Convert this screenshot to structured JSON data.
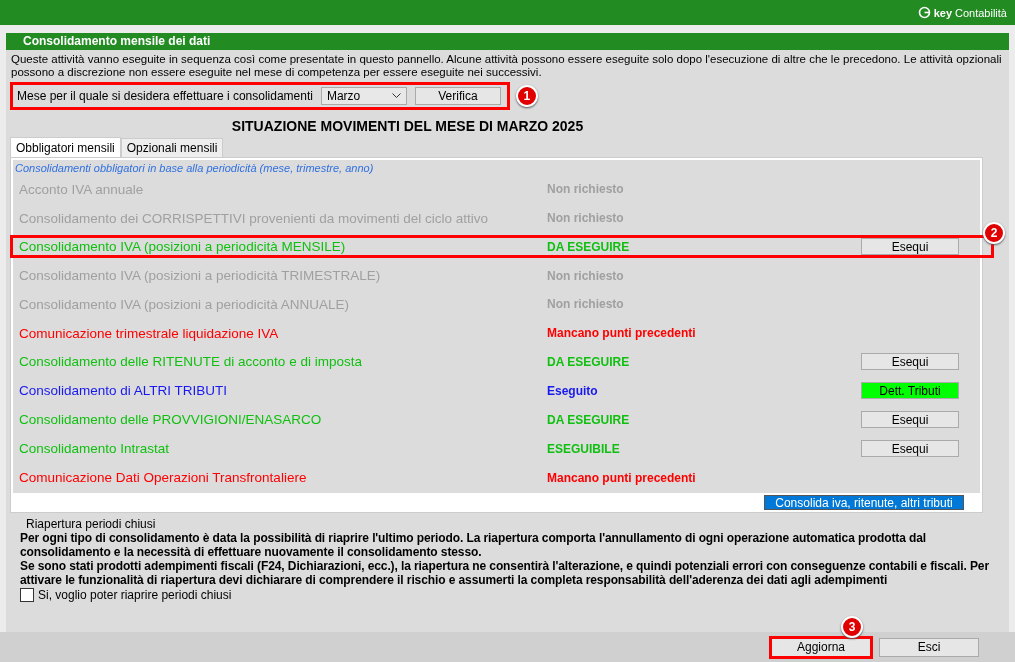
{
  "app_bar": {
    "logo_bold": "key",
    "logo_text": "Contabilità"
  },
  "panel": {
    "title": "Consolidamento mensile dei dati",
    "description": "Queste attività vanno eseguite in sequenza così come presentate in questo pannello. Alcune attività possono essere eseguite solo dopo l'esecuzione di altre che le precedono. Le attività opzionali possono a discrezione non essere eseguite nel mese di competenza per essere eseguite nei successivi."
  },
  "month": {
    "label": "Mese per il quale si desidera effettuare i consolidamenti",
    "value": "Marzo",
    "button": "Verifica",
    "callout": "1"
  },
  "heading": "SITUAZIONE MOVIMENTI DEL MESE DI  MARZO 2025",
  "tabs": [
    {
      "label": "Obbligatori mensili",
      "selected": true
    },
    {
      "label": "Opzionali mensili",
      "selected": false
    }
  ],
  "list_caption": "Consolidamenti obbligatori in base alla periodicità (mese, trimestre, anno)",
  "rows": [
    {
      "label": "Acconto IVA annuale",
      "status": "Non richiesto",
      "color": "#a0a0a0"
    },
    {
      "label": "Consolidamento dei CORRISPETTIVI provenienti da movimenti del ciclo attivo",
      "status": "Non richiesto",
      "color": "#a0a0a0"
    },
    {
      "label": "Consolidamento IVA (posizioni a periodicità MENSILE)",
      "status": "DA ESEGUIRE",
      "color": "#10c010",
      "button": {
        "label": "Esequi",
        "kind": "plain"
      },
      "callout": "2"
    },
    {
      "label": "Consolidamento IVA (posizioni a periodicità TRIMESTRALE)",
      "status": "Non richiesto",
      "color": "#a0a0a0"
    },
    {
      "label": "Consolidamento IVA (posizioni a periodicità ANNUALE)",
      "status": "Non richiesto",
      "color": "#a0a0a0"
    },
    {
      "label": "Comunicazione trimestrale liquidazione IVA",
      "status": "Mancano punti precedenti",
      "color": "#ff0000"
    },
    {
      "label": "Consolidamento delle RITENUTE di acconto e di imposta",
      "status": "DA ESEGUIRE",
      "color": "#10c010",
      "button": {
        "label": "Esequi",
        "kind": "plain"
      }
    },
    {
      "label": "Consolidamento di ALTRI TRIBUTI",
      "status": "Eseguito",
      "color": "#1818f0",
      "button": {
        "label": "Dett. Tributi",
        "kind": "green"
      }
    },
    {
      "label": "Consolidamento delle PROVVIGIONI/ENASARCO",
      "status": "DA ESEGUIRE",
      "color": "#10c010",
      "button": {
        "label": "Esequi",
        "kind": "plain"
      }
    },
    {
      "label": "Consolidamento Intrastat",
      "status": "ESEGUIBILE",
      "color": "#10c010",
      "button": {
        "label": "Esequi",
        "kind": "plain"
      }
    },
    {
      "label": "Comunicazione Dati Operazioni Transfrontaliere",
      "status": "Mancano punti precedenti",
      "color": "#ff0000"
    }
  ],
  "consolidate_button": "Consolida iva, ritenute, altri tributi",
  "reopen": {
    "title": "Riapertura periodi chiusi",
    "text": "Per ogni tipo di consolidamento è data la possibilità di riaprire l'ultimo periodo. La riapertura comporta l'annullamento di ogni operazione automatica prodotta dal consolidamento e la necessità di effettuare nuovamente il consolidamento stesso.\nSe sono stati prodotti adempimenti fiscali (F24, Dichiarazioni, ecc.), la riapertura ne consentirà l'alterazione, e quindi potenziali errori con conseguenze contabili e fiscali. Per attivare le funzionalità di riapertura devi dichiarare di comprendere il rischio e assumerti la completa responsabilità dell'aderenza dei dati agli adempimenti",
    "checkbox_label": "Si, voglio poter riaprire periodi chiusi",
    "checked": false
  },
  "footer_buttons": [
    {
      "label": "Aggiorna",
      "callout": "3"
    },
    {
      "label": "Esci"
    }
  ]
}
